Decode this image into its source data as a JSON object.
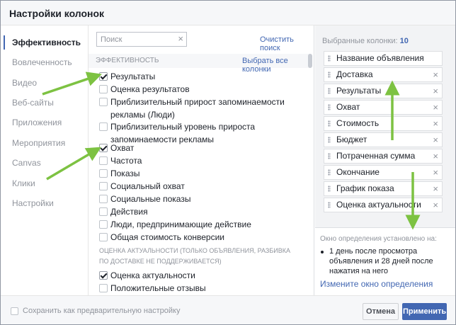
{
  "dialog": {
    "title": "Настройки колонок"
  },
  "nav": {
    "items": [
      {
        "label": "Эффективность",
        "active": true
      },
      {
        "label": "Вовлеченность"
      },
      {
        "label": "Видео"
      },
      {
        "label": "Веб-сайты"
      },
      {
        "label": "Приложения"
      },
      {
        "label": "Мероприятия"
      },
      {
        "label": "Canvas"
      },
      {
        "label": "Клики"
      },
      {
        "label": "Настройки"
      }
    ]
  },
  "search": {
    "placeholder": "Поиск",
    "value": "",
    "clear_icon": "×",
    "clear_link": "Очистить поиск"
  },
  "section": {
    "label": "ЭФФЕКТИВНОСТЬ",
    "select_all": "Выбрать все колонки"
  },
  "options": [
    {
      "label": "Результаты",
      "checked": true
    },
    {
      "label": "Оценка результатов",
      "checked": false
    },
    {
      "label": "Приблизительный прирост запоминаемости рекламы (Люди)",
      "checked": false
    },
    {
      "label": "Приблизительный уровень прироста запоминаемости рекламы",
      "checked": false
    },
    {
      "label": "Охват",
      "checked": true
    },
    {
      "label": "Частота",
      "checked": false
    },
    {
      "label": "Показы",
      "checked": false
    },
    {
      "label": "Социальный охват",
      "checked": false
    },
    {
      "label": "Социальные показы",
      "checked": false
    },
    {
      "label": "Действия",
      "checked": false
    },
    {
      "label": "Люди, предпринимающие действие",
      "checked": false
    },
    {
      "label": "Общая стоимость конверсии",
      "checked": false
    }
  ],
  "relevance_section": {
    "label": "ОЦЕНКА АКТУАЛЬНОСТИ (ТОЛЬКО ОБЪЯВЛЕНИЯ, РАЗБИВКА ПО ДОСТАВКЕ НЕ ПОДДЕРЖИВАЕТСЯ)",
    "options": [
      {
        "label": "Оценка актуальности",
        "checked": true
      },
      {
        "label": "Положительные отзывы",
        "checked": false
      }
    ]
  },
  "selected": {
    "label": "Выбранные колонки:",
    "count": "10",
    "remove_icon": "×",
    "items": [
      {
        "label": "Название объявления",
        "removable": false
      },
      {
        "label": "Доставка",
        "removable": true
      },
      {
        "label": "Результаты",
        "removable": true
      },
      {
        "label": "Охват",
        "removable": true
      },
      {
        "label": "Стоимость",
        "removable": true
      },
      {
        "label": "Бюджет",
        "removable": true
      },
      {
        "label": "Потраченная сумма",
        "removable": true
      },
      {
        "label": "Окончание",
        "removable": true
      },
      {
        "label": "График показа",
        "removable": true
      },
      {
        "label": "Оценка актуальности",
        "removable": true
      }
    ]
  },
  "attribution": {
    "heading": "Окно определения установлено на:",
    "item": "1 день после просмотра объявления и 28 дней после нажатия на него",
    "change_link": "Измените окно определения"
  },
  "footer": {
    "save_preset": "Сохранить как предварительную настройку",
    "cancel": "Отмена",
    "apply": "Применить"
  },
  "colors": {
    "accent": "#4267b2",
    "annotation_arrow": "#7dc242"
  }
}
